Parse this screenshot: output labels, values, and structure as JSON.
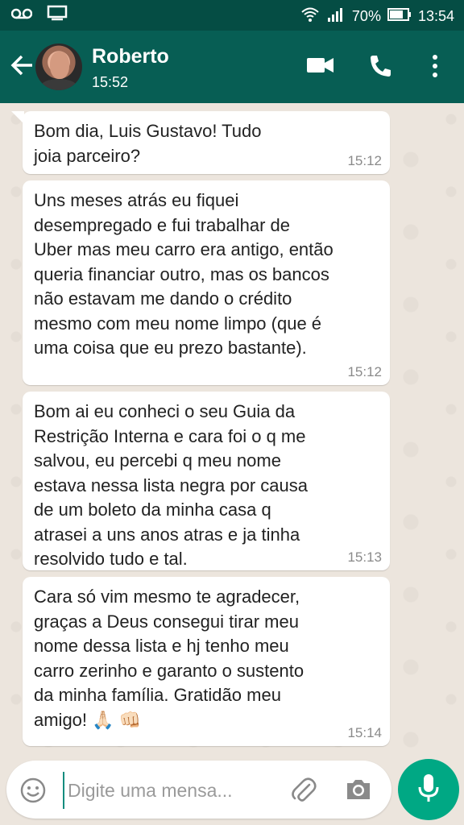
{
  "status_bar": {
    "battery": "70%",
    "time": "13:54"
  },
  "header": {
    "contact_name": "Roberto",
    "contact_status": "15:52",
    "icons": [
      "back-arrow-icon",
      "video-call-icon",
      "voice-call-icon",
      "more-options-icon"
    ]
  },
  "messages": [
    {
      "text": "Bom dia, Luis Gustavo! Tudo\njoia parceiro?",
      "time": "15:12"
    },
    {
      "text": "Uns meses atrás eu fiquei\ndesempregado e fui trabalhar de\nUber mas meu carro era antigo, então\nqueria financiar outro, mas os bancos\nnão estavam me dando o crédito\nmesmo com meu nome limpo (que é\numa coisa que eu prezo bastante).",
      "time": "15:12"
    },
    {
      "text": "Bom ai eu conheci o seu Guia da\nRestrição Interna e cara foi o q me\nsalvou, eu percebi q meu nome\nestava nessa lista negra por causa\nde um boleto da minha casa q\natrasei a uns anos atras e ja tinha\nresolvido tudo e tal.",
      "time": "15:13"
    },
    {
      "text": "Cara só vim mesmo te agradecer,\ngraças a Deus consegui tirar meu\nnome dessa lista e hj tenho meu\ncarro zerinho e garanto o sustento\nda minha família. Gratidão meu\namigo! 🙏🏻 👊🏻",
      "time": "15:14"
    }
  ],
  "composer": {
    "placeholder": "Digite uma mensa..."
  },
  "colors": {
    "header": "#075e54",
    "status_bar": "#054d44",
    "chat_background": "#ece5dd",
    "mic_button": "#00a884"
  }
}
